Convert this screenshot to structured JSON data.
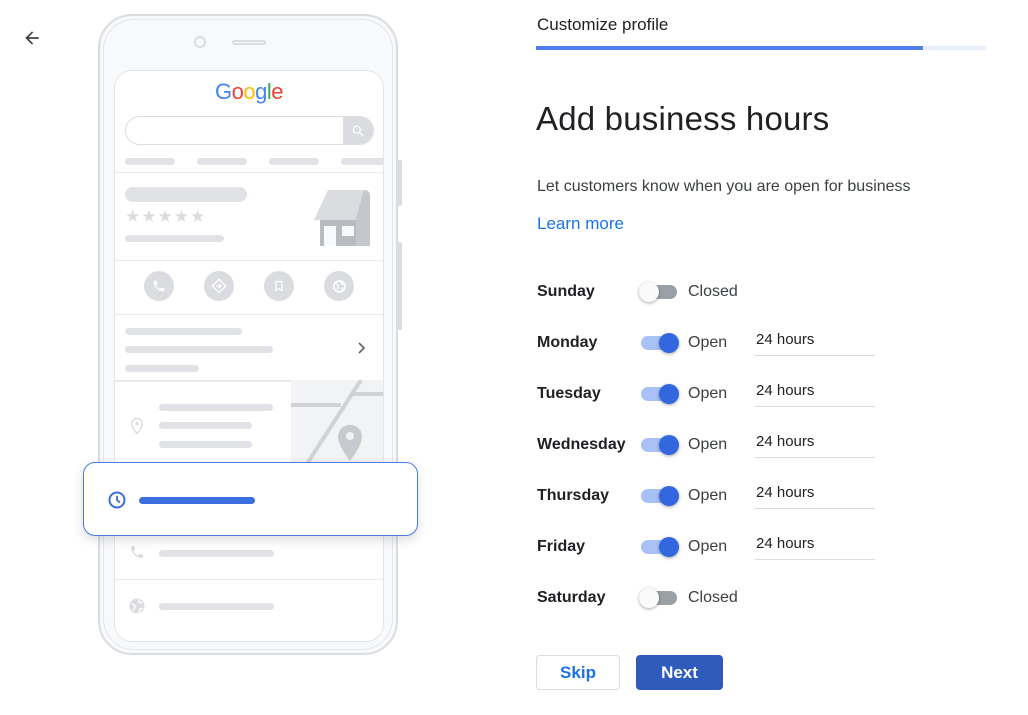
{
  "nav": {
    "back_icon": "arrow-left-icon"
  },
  "illustration": {
    "logo_letters": [
      {
        "char": "G",
        "color": "#4285f4"
      },
      {
        "char": "o",
        "color": "#ea4335"
      },
      {
        "char": "o",
        "color": "#fbbc05"
      },
      {
        "char": "g",
        "color": "#4285f4"
      },
      {
        "char": "l",
        "color": "#34a853"
      },
      {
        "char": "e",
        "color": "#ea4335"
      }
    ],
    "rating_stars": "★★★★★",
    "action_icons": [
      "phone-icon",
      "directions-icon",
      "bookmark-icon",
      "globe-icon"
    ],
    "highlight_icon": "clock-icon",
    "highlight_color": "#3b6fe0"
  },
  "header": {
    "step_title": "Customize profile",
    "progress": 0.86,
    "progress_color": "#4f80ee"
  },
  "main": {
    "title": "Add business hours",
    "subtitle": "Let customers know when you are open for business",
    "learn_more": "Learn more",
    "days": [
      {
        "day": "Sunday",
        "open": false,
        "status": "Closed",
        "hours": ""
      },
      {
        "day": "Monday",
        "open": true,
        "status": "Open",
        "hours": "24 hours"
      },
      {
        "day": "Tuesday",
        "open": true,
        "status": "Open",
        "hours": "24 hours"
      },
      {
        "day": "Wednesday",
        "open": true,
        "status": "Open",
        "hours": "24 hours"
      },
      {
        "day": "Thursday",
        "open": true,
        "status": "Open",
        "hours": "24 hours"
      },
      {
        "day": "Friday",
        "open": true,
        "status": "Open",
        "hours": "24 hours"
      },
      {
        "day": "Saturday",
        "open": false,
        "status": "Closed",
        "hours": ""
      }
    ]
  },
  "footer": {
    "skip_label": "Skip",
    "next_label": "Next",
    "next_color": "#2f5bbd"
  }
}
